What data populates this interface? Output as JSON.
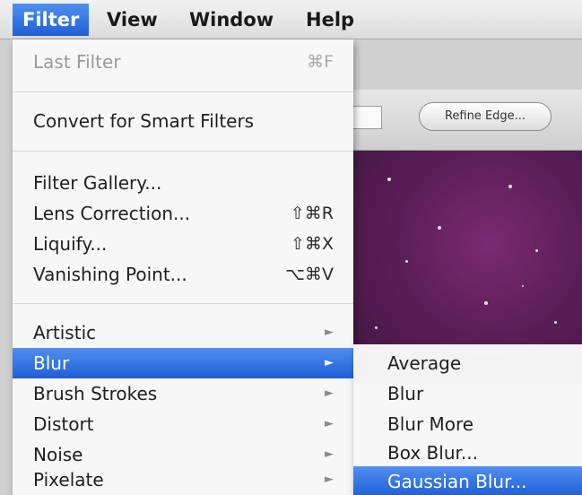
{
  "menubar": {
    "items": [
      {
        "label": "Filter",
        "active": true
      },
      {
        "label": "View",
        "active": false
      },
      {
        "label": "Window",
        "active": false
      },
      {
        "label": "Help",
        "active": false
      }
    ]
  },
  "options_bar": {
    "refine_edge_label": "Refine Edge..."
  },
  "filter_menu": {
    "last_filter": {
      "label": "Last Filter",
      "shortcut": "⌘F",
      "enabled": false
    },
    "convert_smart": {
      "label": "Convert for Smart Filters"
    },
    "filter_gallery": {
      "label": "Filter Gallery..."
    },
    "lens_correction": {
      "label": "Lens Correction...",
      "shortcut": "⇧⌘R"
    },
    "liquify": {
      "label": "Liquify...",
      "shortcut": "⇧⌘X"
    },
    "vanishing_point": {
      "label": "Vanishing Point...",
      "shortcut": "⌥⌘V"
    },
    "artistic": {
      "label": "Artistic"
    },
    "blur": {
      "label": "Blur",
      "highlighted": true
    },
    "brush_strokes": {
      "label": "Brush Strokes"
    },
    "distort": {
      "label": "Distort"
    },
    "noise": {
      "label": "Noise"
    },
    "pixelate": {
      "label": "Pixelate"
    },
    "submenu_arrow": "►"
  },
  "blur_submenu": {
    "items": [
      {
        "label": "Average",
        "highlighted": false
      },
      {
        "label": "Blur",
        "highlighted": false
      },
      {
        "label": "Blur More",
        "highlighted": false
      },
      {
        "label": "Box Blur...",
        "highlighted": false
      },
      {
        "label": "Gaussian Blur...",
        "highlighted": true
      }
    ]
  },
  "colors": {
    "highlight": "#2f6fe0",
    "canvas": "#5c1f58"
  }
}
